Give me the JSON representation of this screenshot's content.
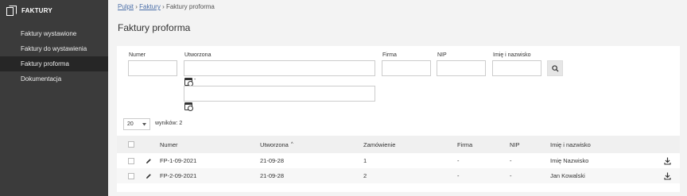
{
  "sidebar": {
    "brand": "FAKTURY",
    "items": [
      {
        "label": "Faktury wystawione"
      },
      {
        "label": "Faktury do wystawienia"
      },
      {
        "label": "Faktury proforma"
      },
      {
        "label": "Dokumentacja"
      }
    ]
  },
  "breadcrumb": {
    "home": "Pulpit",
    "sep1": "›",
    "section": "Faktury",
    "sep2": "›",
    "current": "Faktury proforma"
  },
  "page_title": "Faktury proforma",
  "filters": {
    "numer": {
      "label": "Numer",
      "value": ""
    },
    "utworzona": {
      "label": "Utworzona",
      "from": "",
      "to": "",
      "dash": "-"
    },
    "firma": {
      "label": "Firma",
      "value": ""
    },
    "nip": {
      "label": "NIP",
      "value": ""
    },
    "imie": {
      "label": "Imię i nazwisko",
      "value": ""
    }
  },
  "pagination": {
    "page_size": "20",
    "count_text": "wyników: 2"
  },
  "table": {
    "headers": {
      "numer": "Numer",
      "utworzona": "Utworzona",
      "sort_indicator": "^",
      "zamowienie": "Zamówienie",
      "firma": "Firma",
      "nip": "NIP",
      "imie": "Imię i nazwisko"
    },
    "rows": [
      {
        "numer": "FP-1-09-2021",
        "utworzona": "21-09-28",
        "zamowienie": "1",
        "firma": "-",
        "nip": "-",
        "imie": "Imię Nazwisko"
      },
      {
        "numer": "FP-2-09-2021",
        "utworzona": "21-09-28",
        "zamowienie": "2",
        "firma": "-",
        "nip": "-",
        "imie": "Jan Kowalski"
      }
    ]
  },
  "colors": {
    "sidebar": "#3b3b3b",
    "sidebar_active": "#262626",
    "link": "#4a6ea8"
  },
  "icons": {
    "brand": "documents-icon",
    "calendar": "calendar-clock-icon",
    "search": "search-icon",
    "edit": "pencil-icon",
    "download": "download-icon"
  }
}
